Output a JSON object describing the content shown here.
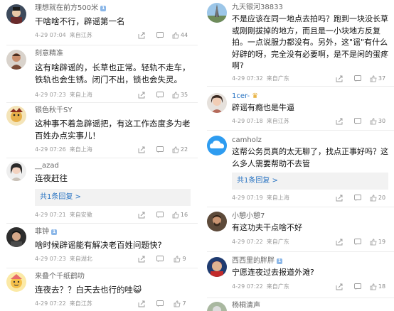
{
  "left_comments": [
    {
      "username": "理想就在前方500米",
      "badge": "1",
      "text": "干啥啥不行，辟谣第一名",
      "time": "4-29 07:04",
      "location": "来自江苏",
      "likes": "44"
    },
    {
      "username": "刻意精准",
      "text": "这有啥辟谣的，长草也正常。轻轨不走车，铁轨也会生锈。闭门不出，锁也会失灵。",
      "time": "4-29 07:23",
      "location": "来自上海",
      "likes": "35"
    },
    {
      "username": "银色秋千SY",
      "text": "这种事不着急辟谣把，有这工作态度多为老百姓办点实事儿！",
      "time": "4-29 07:26",
      "location": "来自上海",
      "likes": "22"
    },
    {
      "username": "__azad",
      "text": "连夜赶往",
      "replies_label": "共1条回复 >",
      "time": "4-29 07:21",
      "location": "来自安徽",
      "likes": "16"
    },
    {
      "username": "菲钟",
      "badge": "1",
      "text": "啥时候辟谣能有解决老百姓问题快?",
      "time": "4-29 07:23",
      "location": "来自湖北",
      "likes": "9"
    },
    {
      "username": "来叠个千纸鹤叻",
      "text": "连夜去？？白天去也行的哇😺",
      "time": "4-29 07:22",
      "location": "来自江苏",
      "likes": "7"
    }
  ],
  "right_comments": [
    {
      "username": "九天银河38833",
      "text": "不是应该在同一地点去拍吗？跑到一块没长草或刚刚拔掉的地方，而且是一小块地方反复拍。一点说服力都没有。另外，这\"谣\"有什么好辟的呀，完全没有必要啊，是不是闲的蛋疼啊?",
      "time": "4-29 07:32",
      "location": "来自广东",
      "likes": "37"
    },
    {
      "username": "1cer-",
      "text": "辟谣有瘾也是牛逼",
      "time": "4-29 07:18",
      "location": "来自江苏",
      "likes": "30"
    },
    {
      "username": "camholz",
      "text": "这帮公务员真的太无聊了，找点正事好吗？这么多人需要帮助不去管",
      "replies_label": "共1条回复 >",
      "time": "4-29 07:19",
      "location": "来自上海",
      "likes": "20"
    },
    {
      "username": "小憩小憩7",
      "text": "有这功夫干点啥不好",
      "time": "4-29 07:22",
      "location": "来自广东",
      "likes": "19"
    },
    {
      "username": "西西里的胖胖",
      "badge": "1",
      "text": "宁愿连夜过去报道外滩?",
      "time": "4-29 07:22",
      "location": "来自广东",
      "likes": "18"
    },
    {
      "username": "杨桐清声",
      "text": "",
      "time": "",
      "location": "",
      "likes": ""
    }
  ]
}
